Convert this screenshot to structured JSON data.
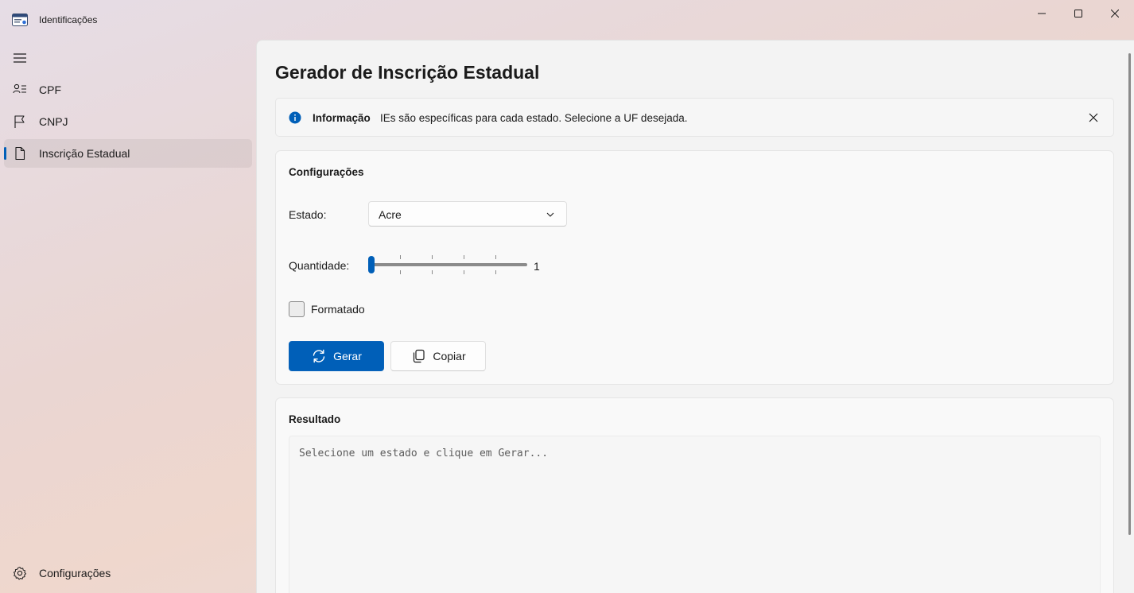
{
  "window": {
    "title": "Identificações",
    "app_icon": "card-id-icon",
    "controls": [
      "minimize-icon",
      "maximize-icon",
      "close-icon"
    ]
  },
  "nav": {
    "menu_icon": "hamburger-icon",
    "items": [
      {
        "label": "CPF",
        "icon": "person-list-icon",
        "selected": false
      },
      {
        "label": "CNPJ",
        "icon": "flag-icon",
        "selected": false
      },
      {
        "label": "Inscrição Estadual",
        "icon": "document-icon",
        "selected": true
      }
    ],
    "footer_item": {
      "label": "Configurações",
      "icon": "gear-icon"
    }
  },
  "page": {
    "title": "Gerador de Inscrição Estadual",
    "info": {
      "title": "Informação",
      "message": "IEs são específicas para cada estado. Selecione a UF desejada.",
      "icon": "info-icon"
    },
    "config": {
      "title": "Configurações",
      "estado_label": "Estado:",
      "estado_value": "Acre",
      "quantidade_label": "Quantidade:",
      "quantidade_value": "1",
      "slider": {
        "min": 1,
        "max": 6,
        "value": 1
      },
      "formatado_label": "Formatado",
      "formatado_checked": false,
      "gerar_label": "Gerar",
      "copiar_label": "Copiar"
    },
    "result": {
      "title": "Resultado",
      "placeholder": "Selecione um estado e clique em Gerar..."
    }
  },
  "colors": {
    "accent": "#005fb8",
    "content_bg": "#f3f3f3",
    "card_bg": "#f9f9f9"
  }
}
